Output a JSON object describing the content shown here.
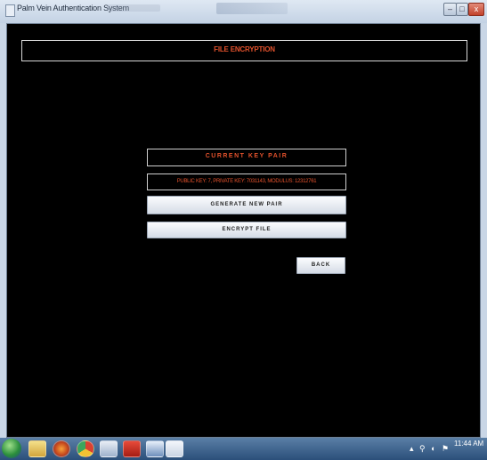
{
  "window": {
    "title": "Palm Vein Authentication System",
    "controls": {
      "minimize": "–",
      "maximize": "□",
      "close": "x"
    }
  },
  "header": {
    "title": "FILE ENCRYPTION"
  },
  "key_panel": {
    "title": "CURRENT KEY PAIR",
    "values": "PUBLIC KEY: 7, PRIVATE KEY: 7031143, MODULUS: 12312761"
  },
  "buttons": {
    "generate": "GENERATE NEW PAIR",
    "encrypt": "ENCRYPT FILE",
    "back": "BACK"
  },
  "taskbar": {
    "icons": [
      "windows-start-icon",
      "folder-icon",
      "firefox-icon",
      "chrome-icon",
      "document-icon",
      "pdf-icon",
      "bag-icon",
      "java-icon"
    ],
    "tray": "▴ ⚲ ◐ ⚑",
    "time": "11:44 AM"
  }
}
